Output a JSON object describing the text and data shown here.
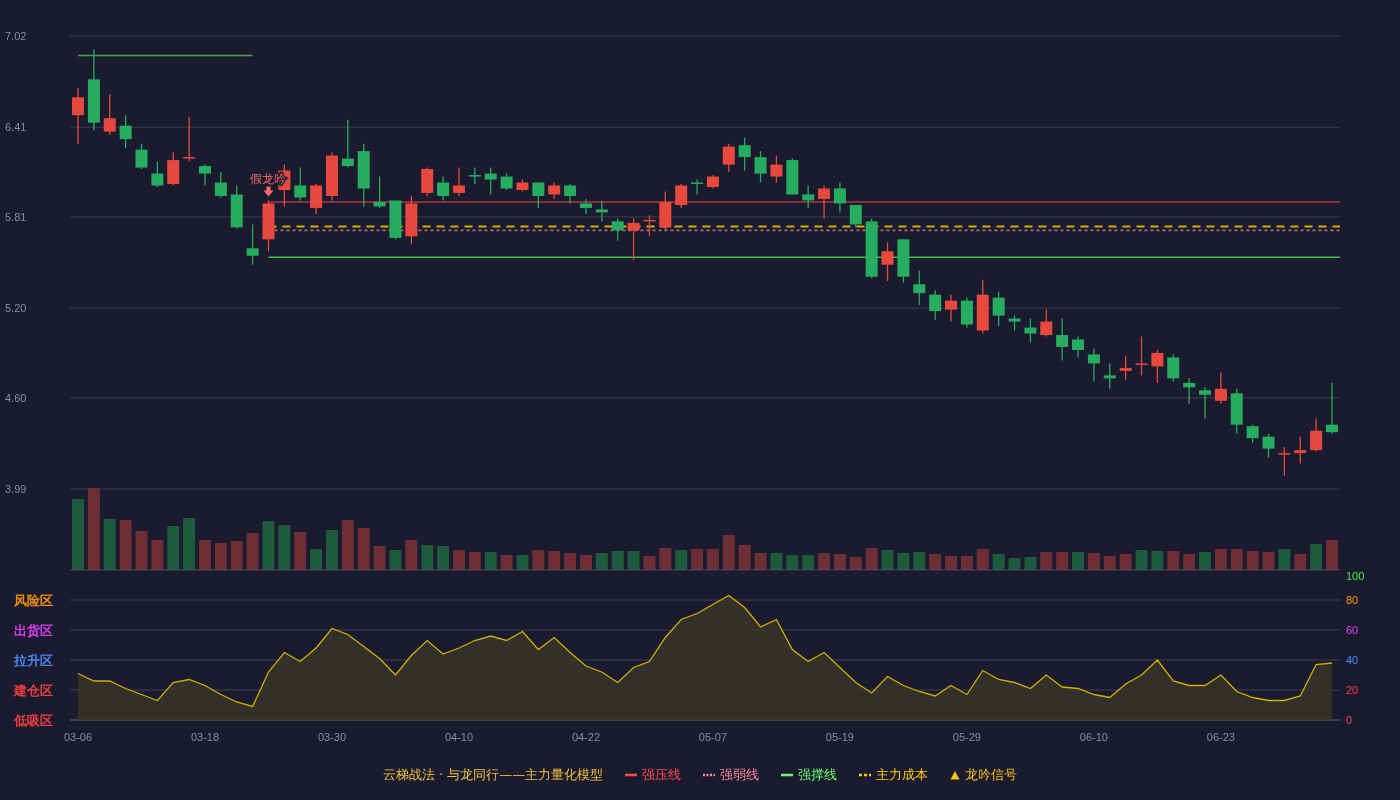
{
  "price_chart": {
    "chart_data": {
      "type": "candlestick",
      "grid": true,
      "ylim": [
        3.99,
        7.02
      ],
      "yticks": [
        7.02,
        6.41,
        5.81,
        {
          "value": 5.2,
          "label": "5.20"
        },
        {
          "value": 4.6,
          "label": "4.60"
        },
        3.99
      ],
      "categories": [
        null,
        null,
        null,
        null,
        null,
        null,
        null,
        null,
        null,
        null,
        null,
        null,
        null,
        null,
        null,
        null,
        null,
        null,
        null,
        null,
        null,
        null,
        null,
        null,
        null,
        null,
        null,
        null,
        null,
        null,
        null,
        null,
        null,
        null,
        null,
        null,
        null,
        null,
        null,
        null,
        null,
        null,
        null,
        null,
        null,
        null,
        null,
        null,
        null,
        null,
        null,
        null,
        null,
        null,
        null,
        null,
        null,
        null,
        null,
        null,
        null,
        null,
        null,
        null,
        null,
        null,
        null,
        null,
        null,
        null,
        null,
        null,
        null,
        null,
        null,
        null,
        null,
        null,
        null,
        null
      ],
      "ohlc": [
        [
          6.49,
          6.67,
          6.3,
          6.61
        ],
        [
          6.73,
          6.93,
          6.39,
          6.44
        ],
        [
          6.38,
          6.63,
          6.36,
          6.47
        ],
        [
          6.42,
          6.49,
          6.27,
          6.33
        ],
        [
          6.26,
          6.3,
          6.13,
          6.14
        ],
        [
          6.1,
          6.18,
          6.01,
          6.02
        ],
        [
          6.03,
          6.24,
          6.02,
          6.19
        ],
        [
          6.2,
          6.48,
          6.18,
          6.21
        ],
        [
          6.15,
          6.16,
          6.02,
          6.1
        ],
        [
          6.04,
          6.11,
          5.94,
          5.95
        ],
        [
          5.96,
          6.02,
          5.73,
          5.74
        ],
        [
          5.6,
          5.76,
          5.49,
          5.55
        ],
        [
          5.66,
          5.92,
          5.58,
          5.9
        ],
        [
          5.99,
          6.16,
          5.88,
          6.12
        ],
        [
          6.02,
          6.14,
          5.92,
          5.94
        ],
        [
          5.87,
          6.03,
          5.83,
          6.02
        ],
        [
          5.95,
          6.24,
          5.92,
          6.22
        ],
        [
          6.2,
          6.46,
          6.14,
          6.15
        ],
        [
          6.25,
          6.3,
          5.88,
          6.0
        ],
        [
          5.91,
          6.08,
          5.87,
          5.88
        ],
        [
          5.92,
          5.92,
          5.66,
          5.67
        ],
        [
          5.68,
          5.95,
          5.63,
          5.9
        ],
        [
          5.97,
          6.14,
          5.95,
          6.13
        ],
        [
          6.04,
          6.08,
          5.92,
          5.95
        ],
        [
          5.97,
          6.14,
          5.95,
          6.02
        ],
        [
          6.09,
          6.14,
          6.03,
          6.08
        ],
        [
          6.1,
          6.14,
          5.96,
          6.06
        ],
        [
          6.08,
          6.1,
          5.99,
          6.0
        ],
        [
          5.99,
          6.06,
          5.98,
          6.04
        ],
        [
          6.04,
          6.04,
          5.87,
          5.95
        ],
        [
          5.96,
          6.04,
          5.93,
          6.02
        ],
        [
          6.02,
          6.03,
          5.9,
          5.95
        ],
        [
          5.9,
          5.93,
          5.83,
          5.87
        ],
        [
          5.86,
          5.92,
          5.78,
          5.84
        ],
        [
          5.78,
          5.8,
          5.65,
          5.72
        ],
        [
          5.72,
          5.8,
          5.52,
          5.77
        ],
        [
          5.78,
          5.82,
          5.68,
          5.79
        ],
        [
          5.74,
          5.98,
          5.72,
          5.91
        ],
        [
          5.89,
          6.03,
          5.87,
          6.02
        ],
        [
          6.04,
          6.06,
          5.96,
          6.03
        ],
        [
          6.01,
          6.09,
          6.0,
          6.08
        ],
        [
          6.16,
          6.3,
          6.11,
          6.28
        ],
        [
          6.29,
          6.34,
          6.12,
          6.21
        ],
        [
          6.21,
          6.25,
          6.04,
          6.1
        ],
        [
          6.08,
          6.22,
          6.04,
          6.16
        ],
        [
          6.19,
          6.2,
          5.96,
          5.96
        ],
        [
          5.96,
          6.02,
          5.87,
          5.92
        ],
        [
          5.93,
          6.02,
          5.8,
          6.0
        ],
        [
          6.0,
          6.04,
          5.84,
          5.9
        ],
        [
          5.89,
          5.89,
          5.74,
          5.76
        ],
        [
          5.78,
          5.8,
          5.4,
          5.41
        ],
        [
          5.49,
          5.64,
          5.38,
          5.58
        ],
        [
          5.66,
          5.66,
          5.37,
          5.41
        ],
        [
          5.36,
          5.45,
          5.22,
          5.3
        ],
        [
          5.29,
          5.32,
          5.12,
          5.18
        ],
        [
          5.19,
          5.29,
          5.11,
          5.25
        ],
        [
          5.25,
          5.27,
          5.07,
          5.09
        ],
        [
          5.05,
          5.39,
          5.03,
          5.29
        ],
        [
          5.27,
          5.31,
          5.08,
          5.15
        ],
        [
          5.13,
          5.15,
          5.05,
          5.11
        ],
        [
          5.07,
          5.13,
          4.97,
          5.03
        ],
        [
          5.02,
          5.19,
          5.01,
          5.11
        ],
        [
          5.02,
          5.13,
          4.85,
          4.94
        ],
        [
          4.99,
          5.01,
          4.87,
          4.92
        ],
        [
          4.89,
          4.93,
          4.71,
          4.83
        ],
        [
          4.75,
          4.83,
          4.66,
          4.73
        ],
        [
          4.78,
          4.88,
          4.72,
          4.8
        ],
        [
          4.82,
          5.01,
          4.75,
          4.83
        ],
        [
          4.81,
          4.92,
          4.7,
          4.9
        ],
        [
          4.87,
          4.89,
          4.71,
          4.73
        ],
        [
          4.7,
          4.73,
          4.56,
          4.67
        ],
        [
          4.65,
          4.67,
          4.46,
          4.62
        ],
        [
          4.58,
          4.77,
          4.56,
          4.66
        ],
        [
          4.63,
          4.66,
          4.36,
          4.42
        ],
        [
          4.41,
          4.42,
          4.3,
          4.33
        ],
        [
          4.34,
          4.36,
          4.2,
          4.26
        ],
        [
          4.22,
          4.27,
          4.08,
          4.23
        ],
        [
          4.23,
          4.34,
          4.16,
          4.25
        ],
        [
          4.25,
          4.46,
          4.24,
          4.38
        ],
        [
          4.42,
          4.7,
          4.36,
          4.37
        ]
      ],
      "ref_lines": [
        {
          "axis": "y",
          "value": 6.89,
          "color": "#3fa84a"
        },
        {
          "axis": "y",
          "value": 5.91,
          "color": "#b0363c"
        },
        {
          "axis": "y",
          "value": 5.745,
          "color": "#d4b000"
        },
        {
          "axis": "y",
          "value": 5.72,
          "color": "#b46a7a"
        },
        {
          "axis": "y",
          "value": 5.54,
          "color": "#3fbf4a"
        }
      ],
      "annotations": [
        {
          "text": "假龙吟"
        }
      ]
    }
  },
  "indicator": {
    "zones": [
      {
        "label": "风险区",
        "color": "#ff9900"
      },
      {
        "label": "出货区",
        "color": "#e040fb"
      },
      {
        "label": "拉升区",
        "color": "#4a8cff"
      },
      {
        "label": "建仓区",
        "color": "#ff4040"
      },
      {
        "label": "低吸区",
        "color": "#ff4040"
      }
    ],
    "chart_data": {
      "type": "area",
      "grid": true,
      "ylim": [
        0,
        100
      ],
      "yticks": [
        0,
        20,
        40,
        60,
        80,
        100
      ],
      "categories": [
        "03-06",
        null,
        null,
        null,
        null,
        null,
        null,
        null,
        "03-18",
        null,
        null,
        null,
        null,
        null,
        null,
        null,
        "03-30",
        null,
        null,
        null,
        null,
        null,
        null,
        null,
        "04-10",
        null,
        null,
        null,
        null,
        null,
        null,
        null,
        "04-22",
        null,
        null,
        null,
        null,
        null,
        null,
        null,
        "05-07",
        null,
        null,
        null,
        null,
        null,
        null,
        null,
        "05-19",
        null,
        null,
        null,
        null,
        null,
        null,
        null,
        "05-29",
        null,
        null,
        null,
        null,
        null,
        null,
        null,
        "06-10",
        null,
        null,
        null,
        null,
        null,
        null,
        null,
        "06-23",
        null,
        null,
        null,
        null,
        null,
        null,
        null
      ],
      "series": [
        {
          "color": "#d4b000",
          "values": [
            31,
            26,
            26,
            21,
            17,
            13,
            25,
            27,
            23,
            17,
            12,
            9,
            32,
            45,
            39,
            48,
            61,
            57,
            49,
            41,
            30,
            43,
            53,
            44,
            48,
            53,
            56,
            53,
            59,
            47,
            55,
            45,
            36,
            32,
            25,
            35,
            39,
            55,
            67,
            71,
            77,
            83,
            75,
            62,
            67,
            47,
            39,
            45,
            35,
            25,
            18,
            29,
            23,
            19,
            16,
            23,
            17,
            33,
            27,
            25,
            21,
            30,
            22,
            21,
            17,
            15,
            24,
            30,
            40,
            26,
            23,
            23,
            30,
            19,
            15,
            13,
            13,
            16,
            37,
            38
          ]
        }
      ]
    }
  },
  "legend": {
    "title": "云梯战法 · 与龙同行——主力量化模型",
    "items": [
      {
        "label": "强压线",
        "kind": "solid",
        "color": "#ff4d4d"
      },
      {
        "label": "强弱线",
        "kind": "dotted",
        "color": "#ff8a9a"
      },
      {
        "label": "强撑线",
        "kind": "solid",
        "color": "#6cff6c"
      },
      {
        "label": "主力成本",
        "kind": "dashed",
        "color": "#ffd000"
      },
      {
        "label": "龙吟信号",
        "kind": "marker",
        "color": "#f5c518"
      }
    ]
  }
}
